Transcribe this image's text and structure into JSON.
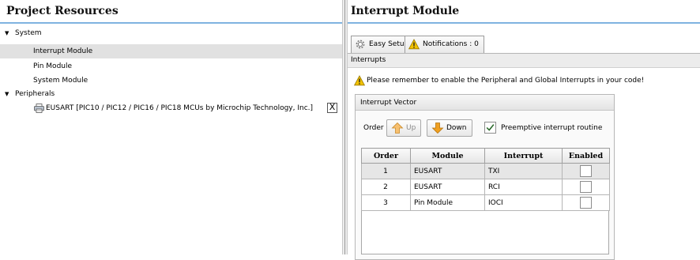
{
  "left_panel": {
    "title": "Project Resources",
    "tree": [
      {
        "label": "System",
        "type": "group"
      },
      {
        "label": "Interrupt Module",
        "type": "item",
        "selected": true
      },
      {
        "label": "Pin Module",
        "type": "item"
      },
      {
        "label": "System Module",
        "type": "item"
      },
      {
        "label": "Peripherals",
        "type": "group"
      },
      {
        "label": "EUSART [PIC10 / PIC12 / PIC16 / PIC18 MCUs  by Microchip Technology, Inc.]",
        "type": "peripheral",
        "icon": "printer-icon",
        "close_label": "X"
      }
    ]
  },
  "right_panel": {
    "title": "Interrupt Module",
    "tabs": [
      {
        "label": "Easy Setup",
        "icon": "gear-icon"
      },
      {
        "label": "Notifications : 0",
        "icon": "warning-icon"
      }
    ],
    "section_label": "Interrupts",
    "warning_text": "Please remember to enable the Peripheral and Global Interrupts in your code!",
    "vector": {
      "title": "Interrupt Vector",
      "order_label": "Order",
      "up_label": "Up",
      "down_label": "Down",
      "preemptive_label": "Preemptive interrupt routine",
      "preemptive_checked": true,
      "columns": [
        "Order",
        "Module",
        "Interrupt",
        "Enabled"
      ],
      "rows": [
        {
          "order": "1",
          "module": "EUSART",
          "interrupt": "TXI",
          "enabled": false
        },
        {
          "order": "2",
          "module": "EUSART",
          "interrupt": "RCI",
          "enabled": false
        },
        {
          "order": "3",
          "module": "Pin Module",
          "interrupt": "IOCI",
          "enabled": false
        }
      ]
    }
  },
  "colors": {
    "accent_line": "#7fb3e0",
    "selected_row": "#e1e1e1",
    "warning": "#f2c200",
    "arrow": "#f0a020"
  }
}
